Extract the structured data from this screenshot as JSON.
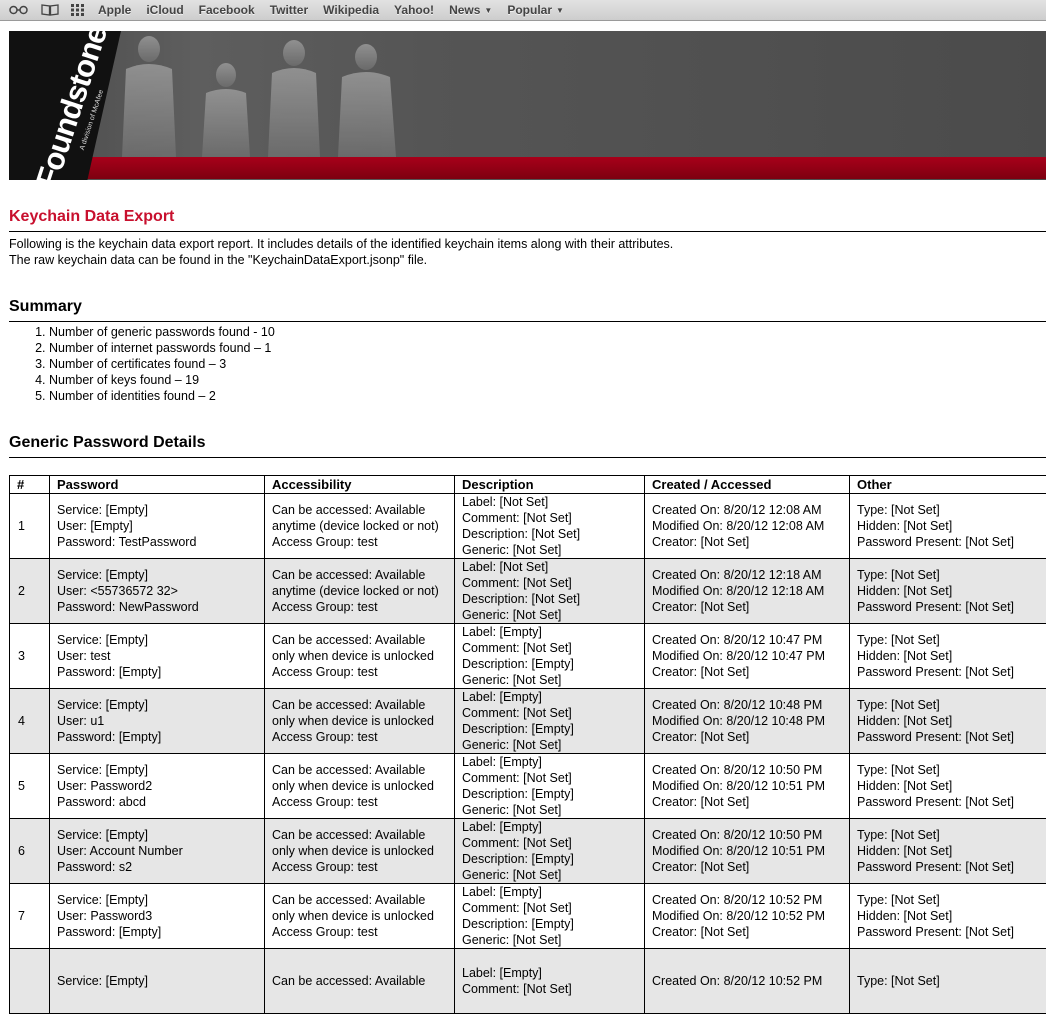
{
  "bookmarks_bar": {
    "icons": [
      "reading-list-icon",
      "bookmarks-book-icon",
      "top-sites-grid-icon"
    ],
    "links": [
      {
        "label": "Apple",
        "dropdown": false
      },
      {
        "label": "iCloud",
        "dropdown": false
      },
      {
        "label": "Facebook",
        "dropdown": false
      },
      {
        "label": "Twitter",
        "dropdown": false
      },
      {
        "label": "Wikipedia",
        "dropdown": false
      },
      {
        "label": "Yahoo!",
        "dropdown": false
      },
      {
        "label": "News",
        "dropdown": true
      },
      {
        "label": "Popular",
        "dropdown": true
      }
    ]
  },
  "banner": {
    "logo_text": "Foundstone",
    "logo_sub": "A division of McAfee",
    "colors": {
      "accent_red": "#a8001a",
      "banner_gray": "#555555"
    }
  },
  "report": {
    "title": "Keychain Data Export",
    "intro_line1": "Following is the keychain data export report. It includes details of the identified keychain items along with their attributes.",
    "intro_line2": "The raw keychain data can be found in the \"KeychainDataExport.jsonp\" file.",
    "title_color": "#c8102e"
  },
  "summary": {
    "heading": "Summary",
    "items": [
      "Number of generic passwords found - 10",
      "Number of internet passwords found – 1",
      "Number of certificates found – 3",
      "Number of keys found – 19",
      "Number of identities found – 2"
    ]
  },
  "generic_passwords": {
    "heading": "Generic Password Details",
    "columns": [
      "#",
      "Password",
      "Accessibility",
      "Description",
      "Created / Accessed",
      "Other"
    ],
    "rows": [
      {
        "num": "1",
        "password": [
          "Service: [Empty]",
          "User: [Empty]",
          "Password: TestPassword"
        ],
        "accessibility": [
          "Can be accessed: Available",
          "anytime (device locked or not)",
          "Access Group: test"
        ],
        "description": [
          "Label: [Not Set]",
          "Comment: [Not Set]",
          "Description: [Not Set]",
          "Generic: [Not Set]"
        ],
        "created": [
          "Created On: 8/20/12 12:08 AM",
          "Modified On: 8/20/12 12:08 AM",
          "Creator: [Not Set]"
        ],
        "other": [
          "Type: [Not Set]",
          "Hidden: [Not Set]",
          "Password Present: [Not Set]"
        ]
      },
      {
        "num": "2",
        "password": [
          "Service: [Empty]",
          "User: <55736572 32>",
          "Password: NewPassword"
        ],
        "accessibility": [
          "Can be accessed: Available",
          "anytime (device locked or not)",
          "Access Group: test"
        ],
        "description": [
          "Label: [Not Set]",
          "Comment: [Not Set]",
          "Description: [Not Set]",
          "Generic: [Not Set]"
        ],
        "created": [
          "Created On: 8/20/12 12:18 AM",
          "Modified On: 8/20/12 12:18 AM",
          "Creator: [Not Set]"
        ],
        "other": [
          "Type: [Not Set]",
          "Hidden: [Not Set]",
          "Password Present: [Not Set]"
        ]
      },
      {
        "num": "3",
        "password": [
          "Service: [Empty]",
          "User: test",
          "Password: [Empty]"
        ],
        "accessibility": [
          "Can be accessed: Available",
          "only when device is unlocked",
          "Access Group: test"
        ],
        "description": [
          "Label: [Empty]",
          "Comment: [Not Set]",
          "Description: [Empty]",
          "Generic: [Not Set]"
        ],
        "created": [
          "Created On: 8/20/12 10:47 PM",
          "Modified On: 8/20/12 10:47 PM",
          "Creator: [Not Set]"
        ],
        "other": [
          "Type: [Not Set]",
          "Hidden: [Not Set]",
          "Password Present: [Not Set]"
        ]
      },
      {
        "num": "4",
        "password": [
          "Service: [Empty]",
          "User: u1",
          "Password: [Empty]"
        ],
        "accessibility": [
          "Can be accessed: Available",
          "only when device is unlocked",
          "Access Group: test"
        ],
        "description": [
          "Label: [Empty]",
          "Comment: [Not Set]",
          "Description: [Empty]",
          "Generic: [Not Set]"
        ],
        "created": [
          "Created On: 8/20/12 10:48 PM",
          "Modified On: 8/20/12 10:48 PM",
          "Creator: [Not Set]"
        ],
        "other": [
          "Type: [Not Set]",
          "Hidden: [Not Set]",
          "Password Present: [Not Set]"
        ]
      },
      {
        "num": "5",
        "password": [
          "Service: [Empty]",
          "User: Password2",
          "Password: abcd"
        ],
        "accessibility": [
          "Can be accessed: Available",
          "only when device is unlocked",
          "Access Group: test"
        ],
        "description": [
          "Label: [Empty]",
          "Comment: [Not Set]",
          "Description: [Empty]",
          "Generic: [Not Set]"
        ],
        "created": [
          "Created On: 8/20/12 10:50 PM",
          "Modified On: 8/20/12 10:51 PM",
          "Creator: [Not Set]"
        ],
        "other": [
          "Type: [Not Set]",
          "Hidden: [Not Set]",
          "Password Present: [Not Set]"
        ]
      },
      {
        "num": "6",
        "password": [
          "Service: [Empty]",
          "User: Account Number",
          "Password: s2"
        ],
        "accessibility": [
          "Can be accessed: Available",
          "only when device is unlocked",
          "Access Group: test"
        ],
        "description": [
          "Label: [Empty]",
          "Comment: [Not Set]",
          "Description: [Empty]",
          "Generic: [Not Set]"
        ],
        "created": [
          "Created On: 8/20/12 10:50 PM",
          "Modified On: 8/20/12 10:51 PM",
          "Creator: [Not Set]"
        ],
        "other": [
          "Type: [Not Set]",
          "Hidden: [Not Set]",
          "Password Present: [Not Set]"
        ]
      },
      {
        "num": "7",
        "password": [
          "Service: [Empty]",
          "User: Password3",
          "Password: [Empty]"
        ],
        "accessibility": [
          "Can be accessed: Available",
          "only when device is unlocked",
          "Access Group: test"
        ],
        "description": [
          "Label: [Empty]",
          "Comment: [Not Set]",
          "Description: [Empty]",
          "Generic: [Not Set]"
        ],
        "created": [
          "Created On: 8/20/12 10:52 PM",
          "Modified On: 8/20/12 10:52 PM",
          "Creator: [Not Set]"
        ],
        "other": [
          "Type: [Not Set]",
          "Hidden: [Not Set]",
          "Password Present: [Not Set]"
        ]
      },
      {
        "num": "",
        "password": [
          "Service: [Empty]"
        ],
        "accessibility": [
          "Can be accessed: Available"
        ],
        "description": [
          "Label: [Empty]",
          "Comment: [Not Set]"
        ],
        "created": [
          "Created On: 8/20/12 10:52 PM"
        ],
        "other": [
          "Type: [Not Set]"
        ]
      }
    ]
  }
}
